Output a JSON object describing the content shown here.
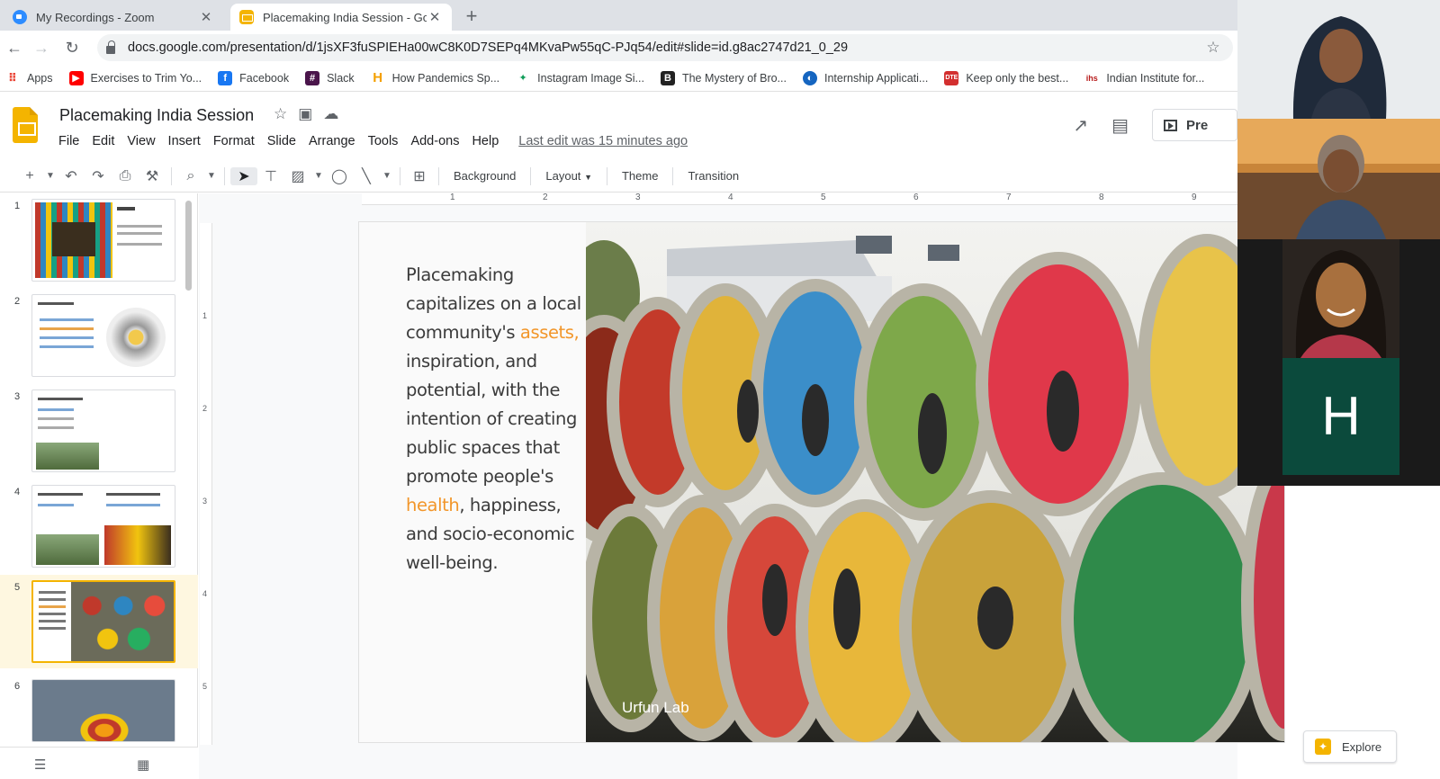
{
  "browser": {
    "tabs": [
      {
        "label": "My Recordings - Zoom",
        "icon": "zoom-favicon"
      },
      {
        "label": "Placemaking India Session - Goo",
        "icon": "slides-favicon"
      }
    ],
    "url": "docs.google.com/presentation/d/1jsXF3fuSPIEHa00wC8K0D7SEPq4MKvaPw55qC-PJq54/edit#slide=id.g8ac2747d21_0_29",
    "bookmarks": [
      {
        "label": "Apps",
        "color": "#ea4335"
      },
      {
        "label": "Exercises to Trim Yo...",
        "color": "#ff0000"
      },
      {
        "label": "Facebook",
        "color": "#1877f2"
      },
      {
        "label": "Slack",
        "color": "#4a154b"
      },
      {
        "label": "How Pandemics Sp...",
        "color": "#f4b400"
      },
      {
        "label": "Instagram Image Si...",
        "color": "#0f9d58"
      },
      {
        "label": "The Mystery of Bro...",
        "color": "#222222"
      },
      {
        "label": "Internship Applicati...",
        "color": "#1565c0"
      },
      {
        "label": "Keep only the best...",
        "color": "#d32f2f"
      },
      {
        "label": "Indian Institute for...",
        "color": "#b71c1c"
      }
    ]
  },
  "app": {
    "title": "Placemaking India Session",
    "menu": [
      "File",
      "Edit",
      "View",
      "Insert",
      "Format",
      "Slide",
      "Arrange",
      "Tools",
      "Add-ons",
      "Help"
    ],
    "last_edit": "Last edit was 15 minutes ago",
    "present_label": "Pre"
  },
  "toolbar": {
    "background": "Background",
    "layout": "Layout",
    "theme": "Theme",
    "transition": "Transition"
  },
  "filmstrip": {
    "slides": [
      "1",
      "2",
      "3",
      "4",
      "5",
      "6"
    ],
    "current": "5"
  },
  "ruler": {
    "h_ticks": [
      "1",
      "2",
      "3",
      "4",
      "5",
      "6",
      "7",
      "8",
      "9"
    ],
    "v_ticks": [
      "1",
      "2",
      "3",
      "4",
      "5"
    ]
  },
  "slide": {
    "text_before_assets": "Placemaking capitalizes on a local community's ",
    "assets": "assets,",
    "text_middle": " inspiration, and potential, with the intention of creating public spaces that promote people's ",
    "health": "health",
    "text_after": ", happiness, and socio-economic well-being.",
    "photo_credit": "Urfun Lab",
    "highlight_color": "#f2962a"
  },
  "zoom": {
    "participant_initial": "H"
  },
  "explore_label": "Explore"
}
